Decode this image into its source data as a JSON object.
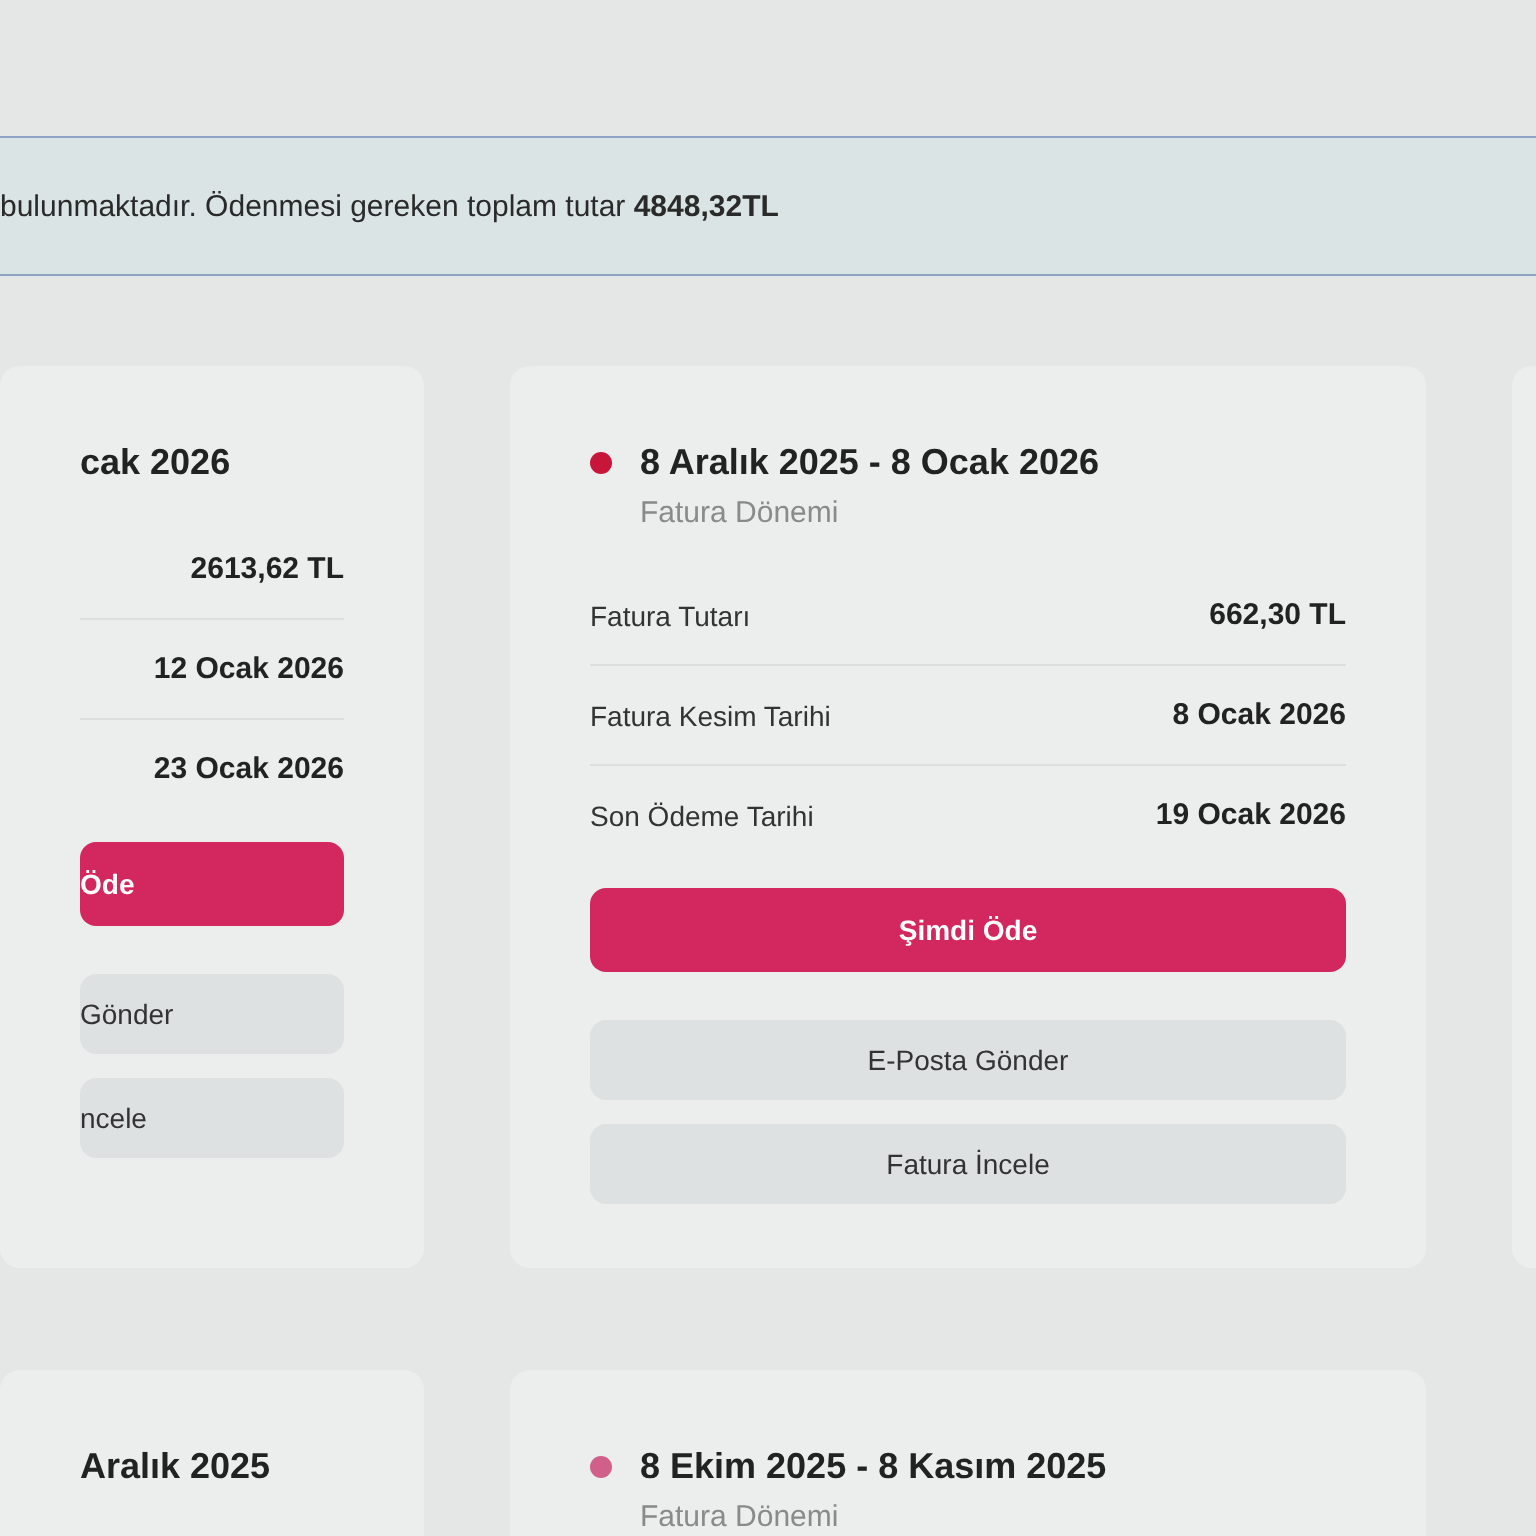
{
  "notice": {
    "text": "bulunmaktadır. Ödenmesi gereken toplam tutar **4848,32TL**"
  },
  "invoices": [
    {
      "title": "cak 2026",
      "rows": [
        {
          "value": "2613,62 TL"
        },
        {
          "value": "12 Ocak 2026"
        },
        {
          "value": "23 Ocak 2026"
        }
      ],
      "buttons": [
        {
          "kind": "primary",
          "label": "Öde"
        },
        {
          "kind": "secondary",
          "label": "Gönder"
        },
        {
          "kind": "secondary",
          "label": "ncele"
        }
      ]
    },
    {
      "title": "8 Aralık 2025 - 8 Ocak 2026",
      "color": "#c8163a",
      "subtitle": "Fatura Dönemi",
      "rows": [
        {
          "label": "Fatura Tutarı",
          "value": "662,30 TL"
        },
        {
          "label": "Fatura Kesim Tarihi",
          "value": "8 Ocak 2026"
        },
        {
          "label": "Son Ödeme Tarihi",
          "value": "19 Ocak 2026"
        }
      ],
      "buttons": [
        {
          "kind": "primary",
          "label": "Şimdi Öde"
        },
        {
          "kind": "secondary",
          "label": "E-Posta Gönder"
        },
        {
          "kind": "secondary",
          "label": "Fatura İncele"
        }
      ]
    },
    {
      "title": "Aralık 2025"
    },
    {
      "title": "8 Ekim 2025 - 8 Kasım 2025",
      "color": "#d0608a",
      "subtitle": "Fatura Dönemi"
    }
  ]
}
